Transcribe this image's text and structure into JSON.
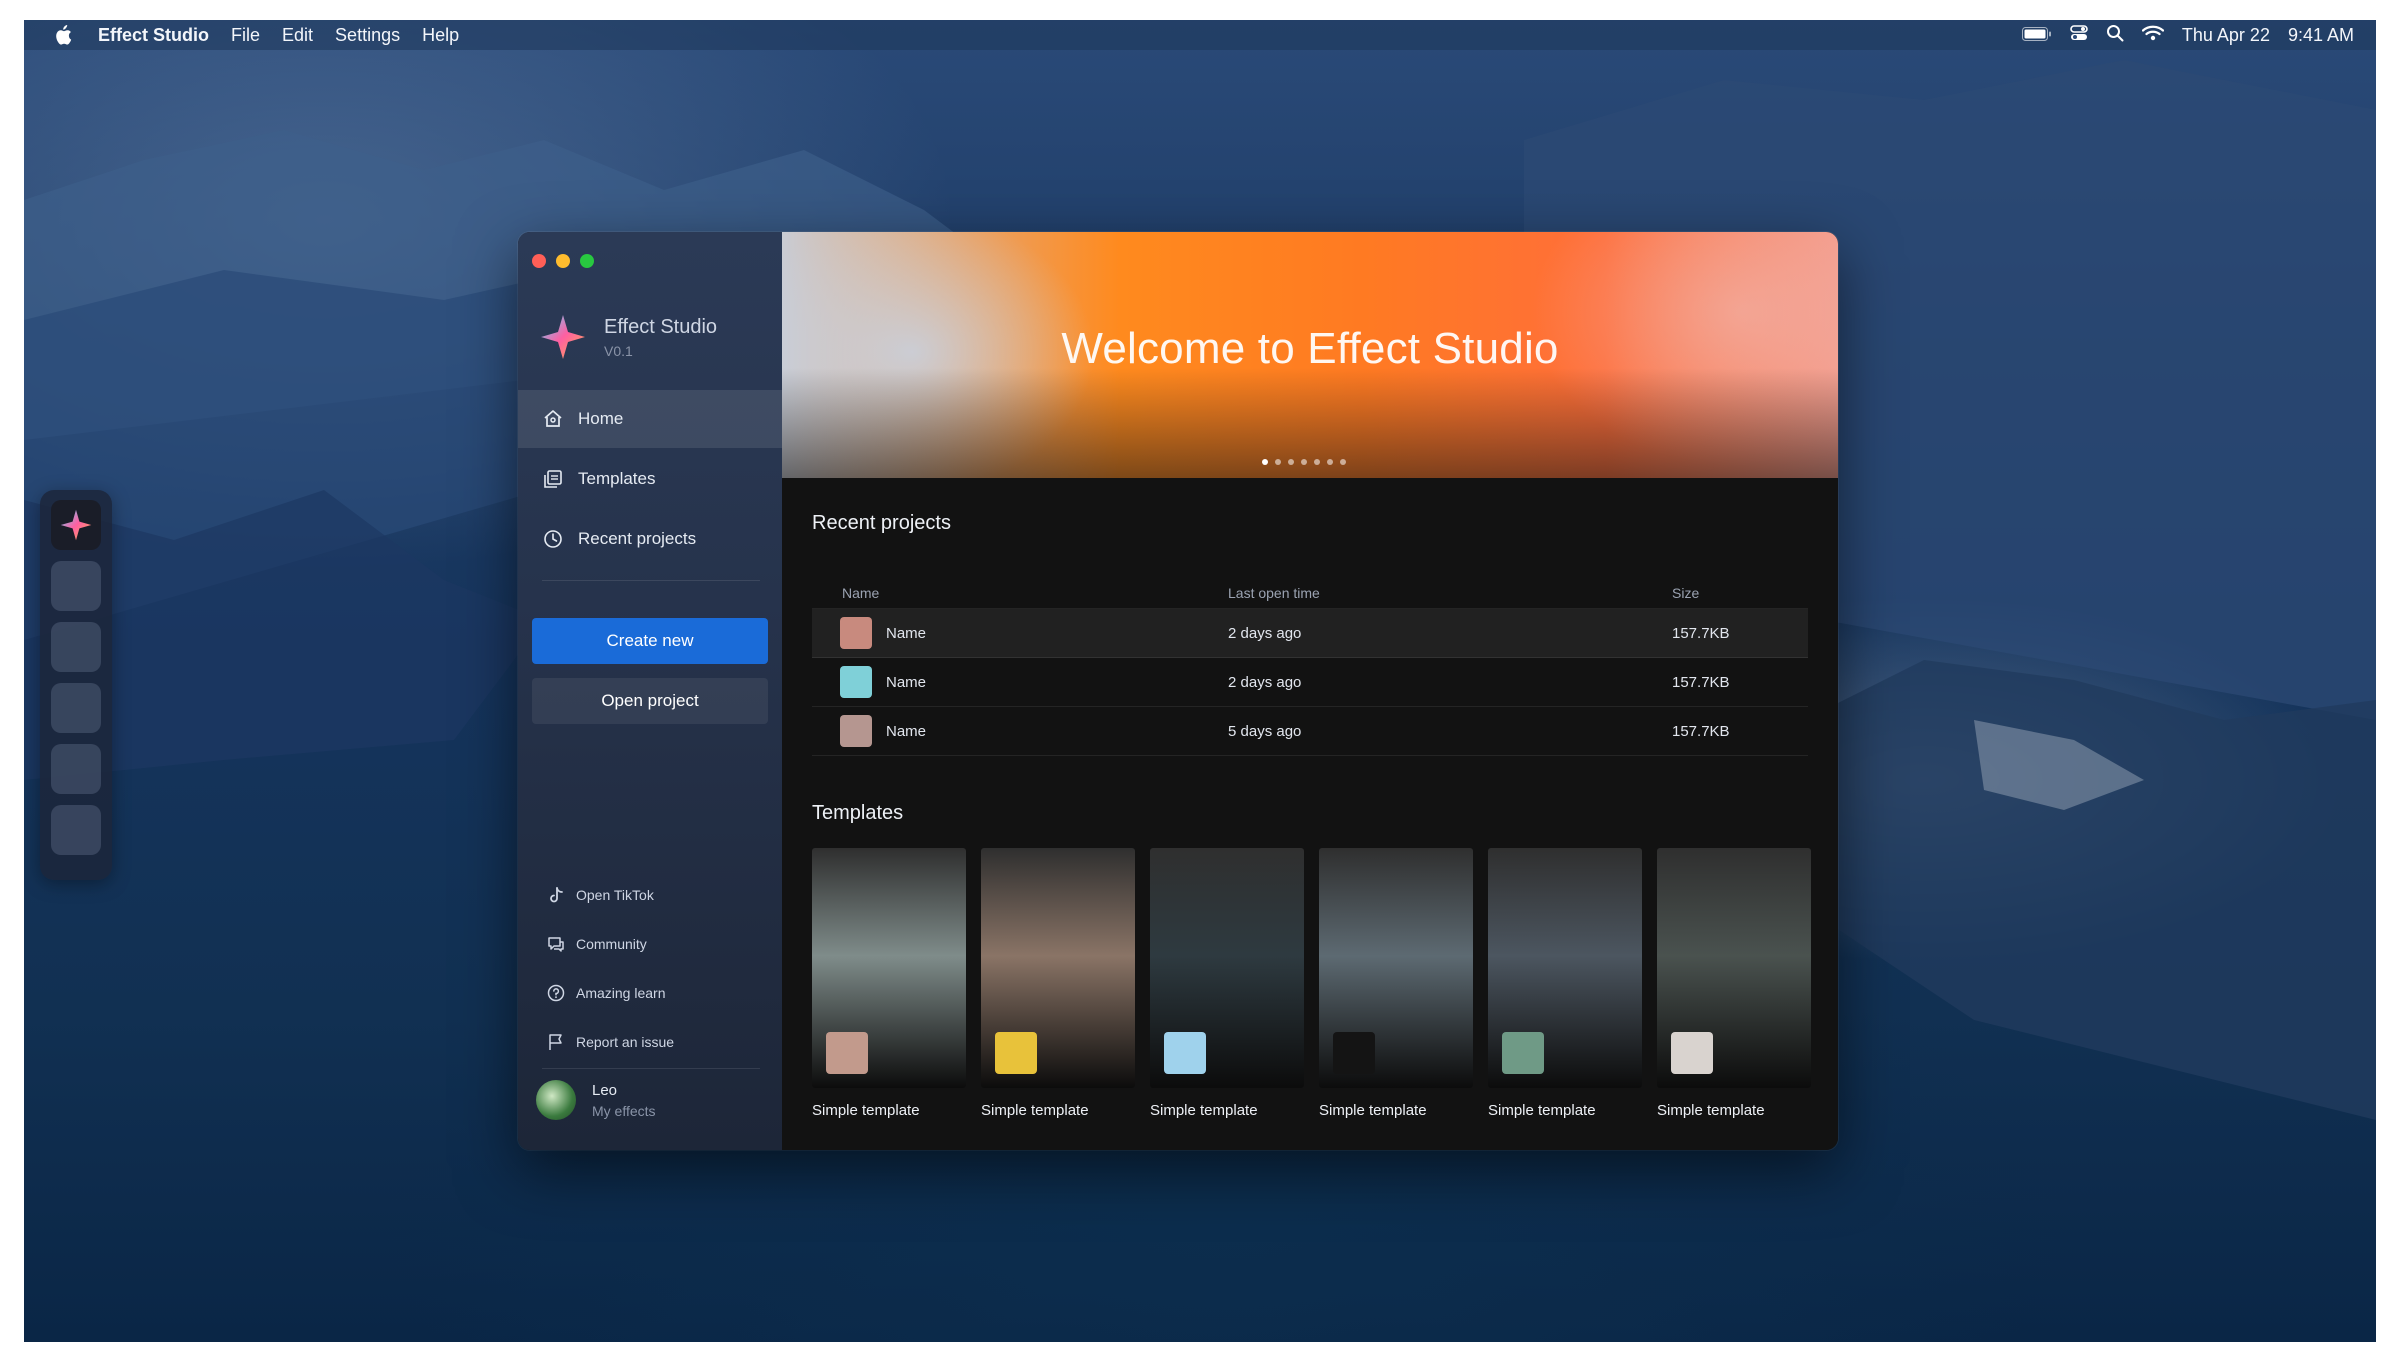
{
  "menubar": {
    "app_name": "Effect Studio",
    "menus": [
      "File",
      "Edit",
      "Settings",
      "Help"
    ],
    "date": "Thu Apr 22",
    "time": "9:41 AM"
  },
  "window": {
    "brand": {
      "name": "Effect Studio",
      "version": "V0.1"
    },
    "nav": [
      {
        "label": "Home",
        "icon": "home-icon",
        "active": true
      },
      {
        "label": "Templates",
        "icon": "templates-icon",
        "active": false
      },
      {
        "label": "Recent projects",
        "icon": "clock-icon",
        "active": false
      }
    ],
    "buttons": {
      "create": "Create new",
      "open": "Open project"
    },
    "links": [
      {
        "label": "Open TikTok",
        "icon": "tiktok-icon"
      },
      {
        "label": "Community",
        "icon": "chat-icon"
      },
      {
        "label": "Amazing learn",
        "icon": "help-icon"
      },
      {
        "label": "Report an issue",
        "icon": "flag-icon"
      }
    ],
    "user": {
      "name": "Leo",
      "subtitle": "My effects"
    }
  },
  "hero": {
    "title": "Welcome to Effect Studio",
    "slides": 7,
    "active_slide": 1
  },
  "recent_projects": {
    "title": "Recent projects",
    "columns": [
      "Name",
      "Last open time",
      "Size"
    ],
    "rows": [
      {
        "name": "Name",
        "time": "2 days ago",
        "size": "157.7KB",
        "thumb": "#c88a7e"
      },
      {
        "name": "Name",
        "time": "2 days ago",
        "size": "157.7KB",
        "thumb": "#7fd0d8"
      },
      {
        "name": "Name",
        "time": "5 days ago",
        "size": "157.7KB",
        "thumb": "#b59690"
      }
    ]
  },
  "templates": {
    "title": "Templates",
    "items": [
      {
        "label": "Simple template",
        "bg": "#7f8c8a",
        "badge": "#c29a8c"
      },
      {
        "label": "Simple template",
        "bg": "#8a7466",
        "badge": "#e8c23a"
      },
      {
        "label": "Simple template",
        "bg": "#2e3a40",
        "badge": "#9fd2ec"
      },
      {
        "label": "Simple template",
        "bg": "#5d6a72",
        "badge": "#141414"
      },
      {
        "label": "Simple template",
        "bg": "#4c5660",
        "badge": "#6f9a86"
      },
      {
        "label": "Simple template",
        "bg": "#4a524f",
        "badge": "#d9d3cf"
      }
    ]
  }
}
